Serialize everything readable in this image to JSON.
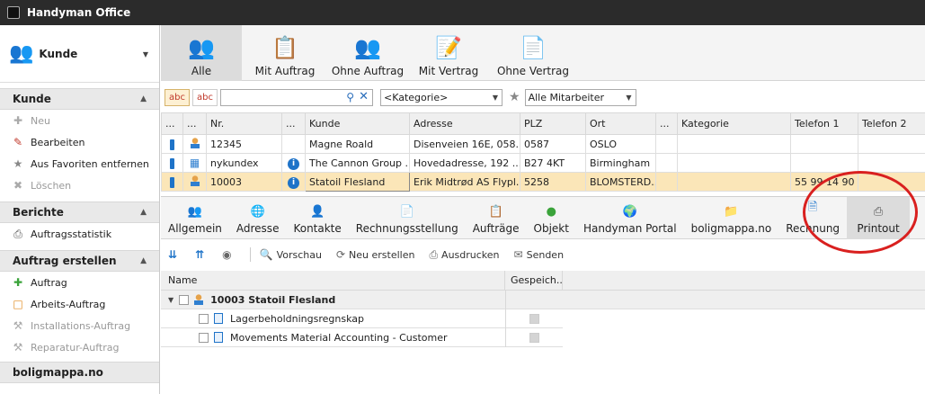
{
  "app": {
    "title": "Handyman Office"
  },
  "sidebar": {
    "module": {
      "label": "Kunde"
    },
    "sections": [
      {
        "title": "Kunde",
        "items": [
          {
            "label": "Neu",
            "icon": "plus-icon",
            "enabled": false
          },
          {
            "label": "Bearbeiten",
            "icon": "edit-icon",
            "enabled": true
          },
          {
            "label": "Aus Favoriten entfernen",
            "icon": "star-icon",
            "enabled": true
          },
          {
            "label": "Löschen",
            "icon": "delete-icon",
            "enabled": false
          }
        ]
      },
      {
        "title": "Berichte",
        "items": [
          {
            "label": "Auftragsstatistik",
            "icon": "printer-icon",
            "enabled": true
          }
        ]
      },
      {
        "title": "Auftrag erstellen",
        "items": [
          {
            "label": "Auftrag",
            "icon": "plus-icon",
            "enabled": true
          },
          {
            "label": "Arbeits-Auftrag",
            "icon": "clipboard-icon",
            "enabled": true
          },
          {
            "label": "Installations-Auftrag",
            "icon": "wrench-icon",
            "enabled": false
          },
          {
            "label": "Reparatur-Auftrag",
            "icon": "wrench-icon",
            "enabled": false
          }
        ]
      },
      {
        "title": "boligmappa.no",
        "items": []
      }
    ]
  },
  "top_tabs": [
    {
      "label": "Alle",
      "icon": "people-icon",
      "active": true
    },
    {
      "label": "Mit Auftrag",
      "icon": "clipboard-icon",
      "active": false
    },
    {
      "label": "Ohne Auftrag",
      "icon": "people-x-icon",
      "active": false
    },
    {
      "label": "Mit Vertrag",
      "icon": "contract-pen-icon",
      "active": false
    },
    {
      "label": "Ohne Vertrag",
      "icon": "contract-x-icon",
      "active": false
    }
  ],
  "filter": {
    "abc1": "abc",
    "abc2": "abc",
    "search_value": "",
    "category": "<Kategorie>",
    "employees": "Alle Mitarbeiter"
  },
  "table": {
    "columns": [
      "...",
      "...",
      "Nr.",
      "...",
      "Kunde",
      "Adresse",
      "PLZ",
      "Ort",
      "...",
      "Kategorie",
      "Telefon 1",
      "Telefon 2"
    ],
    "rows": [
      {
        "nr": "12345",
        "kunde": "Magne Roald",
        "adresse": "Disenveien 16E, 058...",
        "plz": "0587",
        "ort": "OSLO",
        "kategorie": "",
        "tel1": "",
        "tel2": "",
        "info": false,
        "type": "person",
        "selected": false
      },
      {
        "nr": "nykundex",
        "kunde": "The Cannon Group ...",
        "adresse": "Hovedadresse, 192 ...",
        "plz": "B27 4KT",
        "ort": "Birmingham",
        "kategorie": "",
        "tel1": "",
        "tel2": "",
        "info": true,
        "type": "company",
        "selected": false
      },
      {
        "nr": "10003",
        "kunde": "Statoil Flesland",
        "adresse": "Erik Midtrød AS Flypl...",
        "plz": "5258",
        "ort": "BLOMSTERD...",
        "kategorie": "",
        "tel1": "55 99 14 90",
        "tel2": "",
        "info": true,
        "type": "person",
        "selected": true
      }
    ]
  },
  "sub_tabs": [
    {
      "label": "Allgemein",
      "icon": "people-icon"
    },
    {
      "label": "Adresse",
      "icon": "globe-icon"
    },
    {
      "label": "Kontakte",
      "icon": "person-icon"
    },
    {
      "label": "Rechnungsstellung",
      "icon": "document-icon"
    },
    {
      "label": "Aufträge",
      "icon": "clipboard-icon"
    },
    {
      "label": "Objekt",
      "icon": "objects-icon"
    },
    {
      "label": "Handyman Portal",
      "icon": "portal-globe-icon"
    },
    {
      "label": "boligmappa.no",
      "icon": "folder-icon"
    },
    {
      "label": "Rechnung",
      "icon": "invoice-icon"
    },
    {
      "label": "Printout",
      "icon": "printer-icon",
      "active": true
    }
  ],
  "actions": {
    "preview": "Vorschau",
    "regenerate": "Neu erstellen",
    "print": "Ausdrucken",
    "send": "Senden"
  },
  "tree": {
    "col_name": "Name",
    "col_saved": "Gespeich...",
    "root": "10003 Statoil Flesland",
    "children": [
      "Lagerbeholdningsregnskap",
      "Movements Material Accounting - Customer"
    ]
  }
}
